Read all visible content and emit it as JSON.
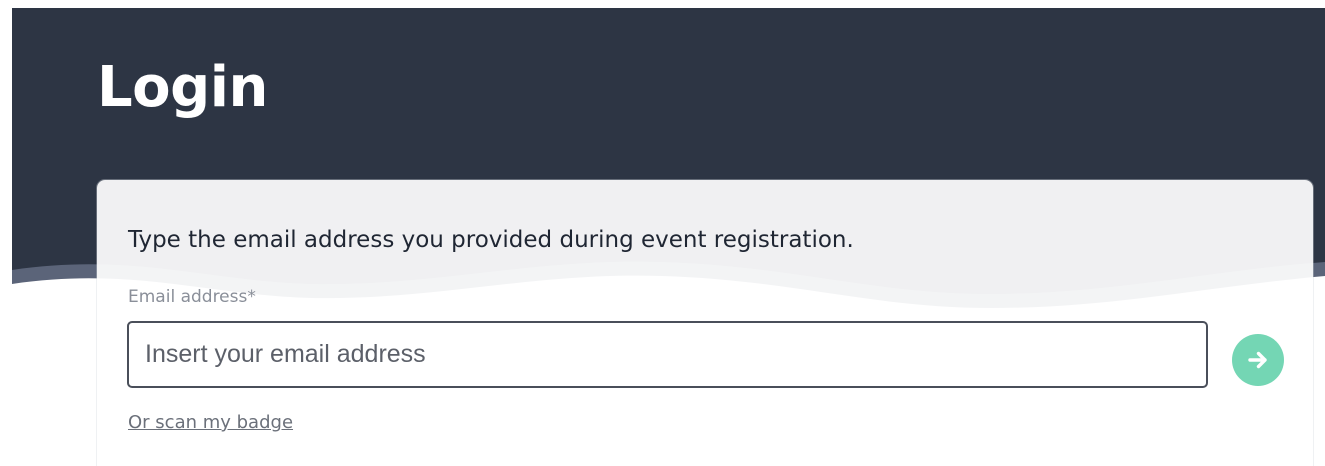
{
  "page": {
    "title": "Login"
  },
  "login_card": {
    "instructions": "Type the email address you provided during event registration.",
    "email_field": {
      "label": "Email address*",
      "placeholder": "Insert your email address",
      "value": ""
    },
    "submit_button": {
      "icon": "arrow-right-icon",
      "aria_label": "Submit"
    },
    "scan_badge_link": "Or scan my badge"
  },
  "colors": {
    "header_background": "#2d3544",
    "header_wave": "#5b6479",
    "card_background": "#ffffff",
    "accent": "#74d6b4",
    "title_text": "#ffffff",
    "body_text": "#1f2633",
    "muted_text": "#8a8f99",
    "input_border": "#4a4f5a"
  }
}
